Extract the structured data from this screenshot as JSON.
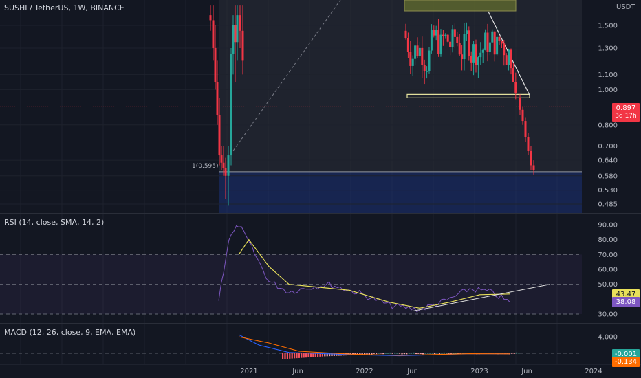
{
  "header": {
    "symbol": "SUSHI / TetherUS, 1W, BINANCE"
  },
  "colors": {
    "background": "#131722",
    "up": "#26a69a",
    "down": "#f23645",
    "rsi": "#7e57c2",
    "rsi_ma": "#e8e05a",
    "macd": "#2962ff",
    "signal": "#ff6d00",
    "zone": "#1c3177",
    "rect": "#6e7a2e"
  },
  "price_pane": {
    "axis_unit": "USDT",
    "y_ticks": [
      "1.500",
      "1.300",
      "1.100",
      "1.000",
      "0.800",
      "0.700",
      "0.640",
      "0.580",
      "0.530",
      "0.485"
    ],
    "fib_label": "1(0.595)",
    "last_price": "0.897",
    "countdown": "3d 17h"
  },
  "rsi_pane": {
    "label": "RSI (14, close, SMA, 14, 2)",
    "y_ticks": [
      "90.00",
      "80.00",
      "70.00",
      "60.00",
      "50.00",
      "30.00"
    ],
    "rsi_ma_value": "43.47",
    "rsi_value": "38.08"
  },
  "macd_pane": {
    "label": "MACD (12, 26, close, 9, EMA, EMA)",
    "y_ticks": [
      "4.000"
    ],
    "hist_value": "-0.001",
    "macd_value": "-0.134"
  },
  "time_axis": {
    "labels": [
      "2021",
      "Jun",
      "2022",
      "Jun",
      "2023",
      "Jun",
      "2024"
    ]
  },
  "chart_data": [
    {
      "type": "candlestick",
      "title": "SUSHI / TetherUS, 1W, BINANCE",
      "x": [
        "2020-12",
        "2021-01",
        "2021-02",
        "2022-05",
        "2022-07",
        "2022-09",
        "2022-11",
        "2023-01",
        "2023-02",
        "2023-03",
        "2023-04",
        "2023-05"
      ],
      "y_scale": "log",
      "y_unit": "USDT",
      "candles_approx": [
        {
          "t": "2020-12",
          "o": 0.61,
          "h": 1.7,
          "l": 0.48,
          "c": 0.62
        },
        {
          "t": "2021-01",
          "o": 0.62,
          "h": 1.6,
          "l": 0.55,
          "c": 1.5
        },
        {
          "t": "2021-02",
          "o": 1.5,
          "h": 1.7,
          "l": 1.0,
          "c": 1.3
        },
        {
          "t": "2022-05",
          "o": 1.6,
          "h": 1.7,
          "l": 0.9,
          "c": 1.2
        },
        {
          "t": "2022-07",
          "o": 1.2,
          "h": 1.6,
          "l": 0.95,
          "c": 1.4
        },
        {
          "t": "2022-09",
          "o": 1.4,
          "h": 1.7,
          "l": 1.0,
          "c": 1.1
        },
        {
          "t": "2022-11",
          "o": 1.1,
          "h": 1.5,
          "l": 0.95,
          "c": 1.3
        },
        {
          "t": "2023-01",
          "o": 1.3,
          "h": 1.58,
          "l": 1.0,
          "c": 1.25
        },
        {
          "t": "2023-02",
          "o": 1.25,
          "h": 1.35,
          "l": 1.0,
          "c": 1.1
        },
        {
          "t": "2023-03",
          "o": 1.1,
          "h": 1.2,
          "l": 0.97,
          "c": 1.0
        },
        {
          "t": "2023-04",
          "o": 1.0,
          "h": 1.05,
          "l": 0.75,
          "c": 0.8
        },
        {
          "t": "2023-05",
          "o": 0.8,
          "h": 0.82,
          "l": 0.59,
          "c": 0.6
        }
      ],
      "last_price": 0.897,
      "fib_level": 0.595
    },
    {
      "type": "line",
      "title": "RSI (14, close, SMA, 14, 2)",
      "ylim": [
        30,
        90
      ],
      "bands": [
        30,
        50,
        70
      ],
      "series": [
        {
          "name": "RSI",
          "points": [
            [
              "2020-12",
              40
            ],
            [
              "2021-01",
              80
            ],
            [
              "2021-02",
              90
            ],
            [
              "2021-03",
              78
            ],
            [
              "2021-05",
              52
            ],
            [
              "2021-07",
              45
            ],
            [
              "2021-09",
              48
            ],
            [
              "2021-11",
              50
            ],
            [
              "2022-02",
              44
            ],
            [
              "2022-05",
              36
            ],
            [
              "2022-08",
              33
            ],
            [
              "2022-11",
              40
            ],
            [
              "2023-01",
              47
            ],
            [
              "2023-03",
              45
            ],
            [
              "2023-05",
              38
            ]
          ]
        },
        {
          "name": "RSI MA",
          "points": [
            [
              "2021-02",
              70
            ],
            [
              "2021-03",
              80
            ],
            [
              "2021-05",
              62
            ],
            [
              "2021-07",
              50
            ],
            [
              "2021-10",
              48
            ],
            [
              "2022-01",
              46
            ],
            [
              "2022-05",
              38
            ],
            [
              "2022-08",
              34
            ],
            [
              "2022-11",
              38
            ],
            [
              "2023-02",
              43
            ],
            [
              "2023-05",
              43.47
            ]
          ]
        }
      ],
      "last_values": {
        "RSI": 38.08,
        "RSI MA": 43.47
      }
    },
    {
      "type": "line",
      "title": "MACD (12, 26, close, 9, EMA, EMA)",
      "series": [
        {
          "name": "MACD",
          "points": [
            [
              "2021-02",
              4.5
            ],
            [
              "2021-04",
              2.0
            ],
            [
              "2021-07",
              0.2
            ],
            [
              "2022-01",
              -0.3
            ],
            [
              "2022-06",
              -0.6
            ],
            [
              "2023-01",
              -0.1
            ],
            [
              "2023-05",
              -0.134
            ]
          ]
        },
        {
          "name": "Signal",
          "points": [
            [
              "2021-02",
              4.0
            ],
            [
              "2021-05",
              2.5
            ],
            [
              "2021-08",
              0.5
            ],
            [
              "2022-01",
              -0.2
            ],
            [
              "2022-06",
              -0.5
            ],
            [
              "2023-01",
              -0.1
            ],
            [
              "2023-05",
              -0.133
            ]
          ]
        }
      ],
      "last_values": {
        "Histogram": -0.001,
        "MACD": -0.134
      }
    }
  ]
}
